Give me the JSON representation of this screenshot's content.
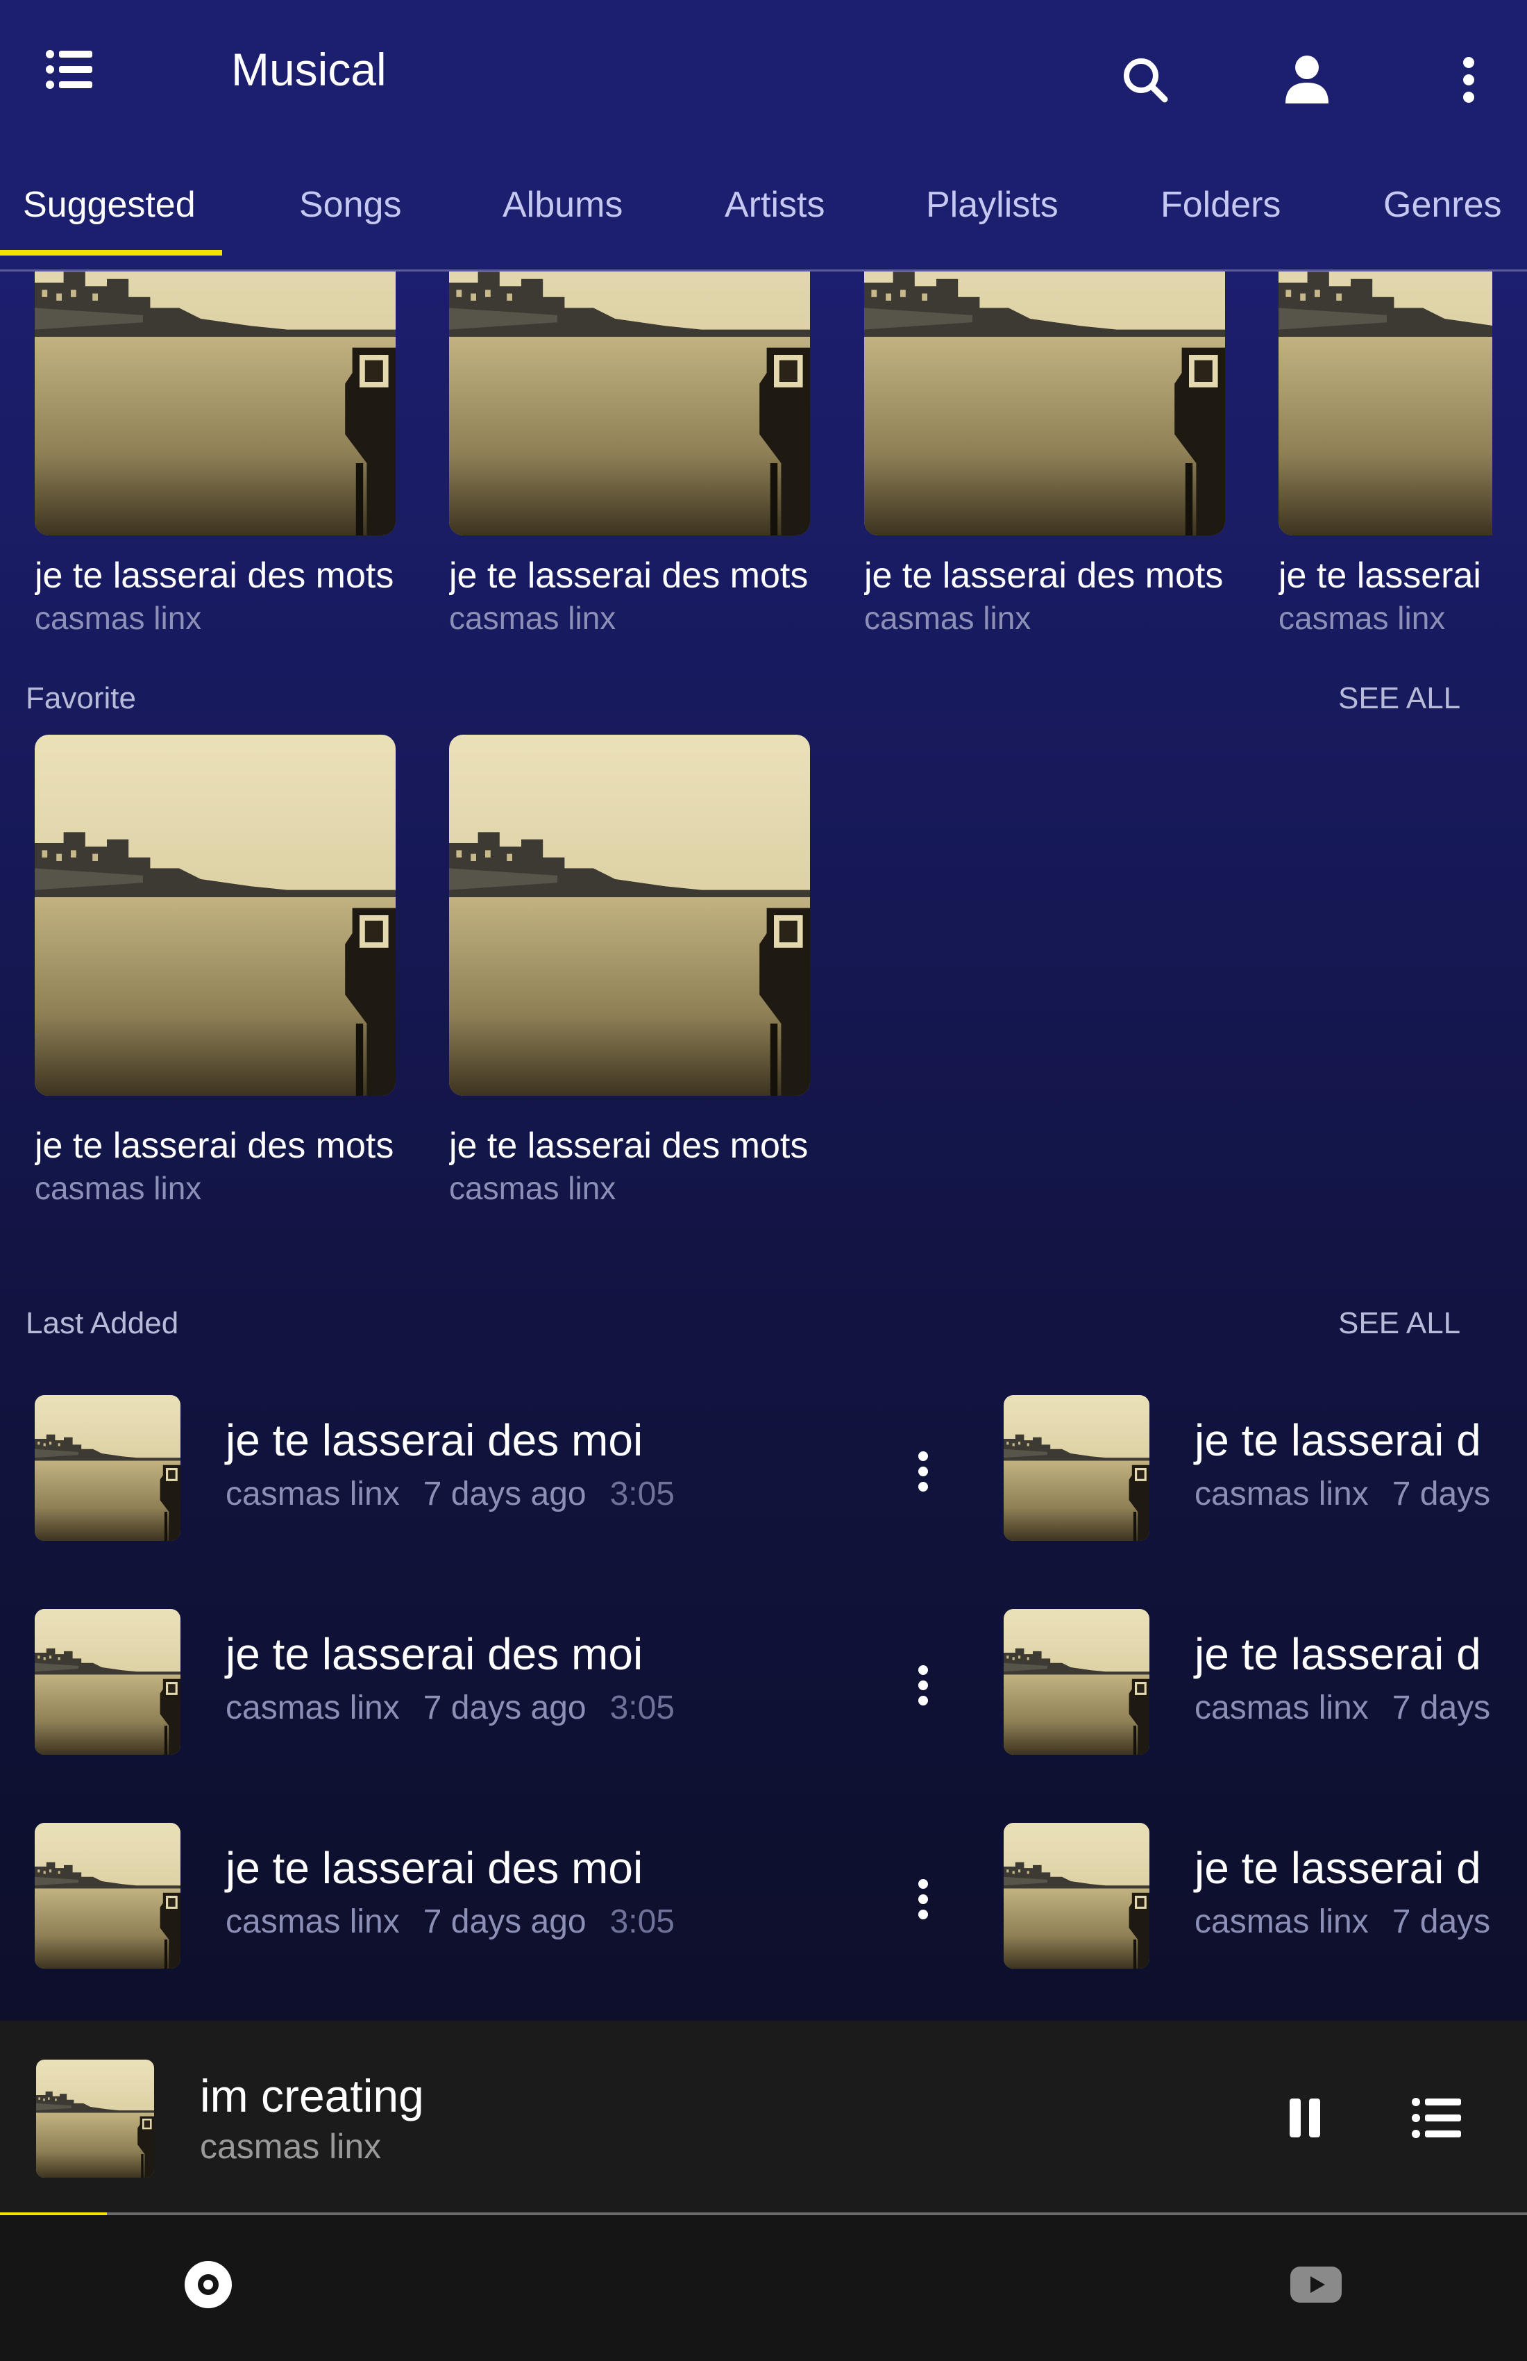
{
  "app": {
    "title": "Musical"
  },
  "tabs": [
    "Suggested",
    "Songs",
    "Albums",
    "Artists",
    "Playlists",
    "Folders",
    "Genres"
  ],
  "active_tab": "Suggested",
  "suggested": {
    "items": [
      {
        "title": "je te lasserai des mots",
        "artist": "casmas linx"
      },
      {
        "title": "je te lasserai des mots",
        "artist": "casmas linx"
      },
      {
        "title": "je te lasserai des mots",
        "artist": "casmas linx"
      },
      {
        "title": "je te lasserai",
        "artist": "casmas linx"
      }
    ]
  },
  "favorite": {
    "label": "Favorite",
    "see_all": "SEE ALL",
    "items": [
      {
        "title": "je te lasserai des mots",
        "artist": "casmas linx"
      },
      {
        "title": "je te lasserai des mots",
        "artist": "casmas linx"
      }
    ]
  },
  "last_added": {
    "label": "Last Added",
    "see_all": "SEE ALL",
    "left": [
      {
        "title": "je te lasserai des moi",
        "artist": "casmas linx",
        "added": "7 days ago",
        "duration": "3:05"
      },
      {
        "title": "je te lasserai des moi",
        "artist": "casmas linx",
        "added": "7 days ago",
        "duration": "3:05"
      },
      {
        "title": "je te lasserai des moi",
        "artist": "casmas linx",
        "added": "7 days ago",
        "duration": "3:05"
      }
    ],
    "right": [
      {
        "title": "je te lasserai d",
        "artist": "casmas linx",
        "added": "7 days"
      },
      {
        "title": "je te lasserai d",
        "artist": "casmas linx",
        "added": "7 days"
      },
      {
        "title": "je te lasserai d",
        "artist": "casmas linx",
        "added": "7 days"
      }
    ]
  },
  "now_playing": {
    "title": "im creating",
    "artist": "casmas linx",
    "progress": 0.07,
    "state": "playing"
  },
  "icons": {
    "menu": "list-menu-icon",
    "search": "search-icon",
    "account": "account-icon",
    "more": "more-vert-icon",
    "pause": "pause-icon",
    "queue": "queue-list-icon",
    "nav_music": "disc-icon",
    "nav_video": "video-play-icon"
  },
  "colors": {
    "accent": "#f6e200",
    "header": "#1c1e6e",
    "player": "#1b1b1b"
  }
}
